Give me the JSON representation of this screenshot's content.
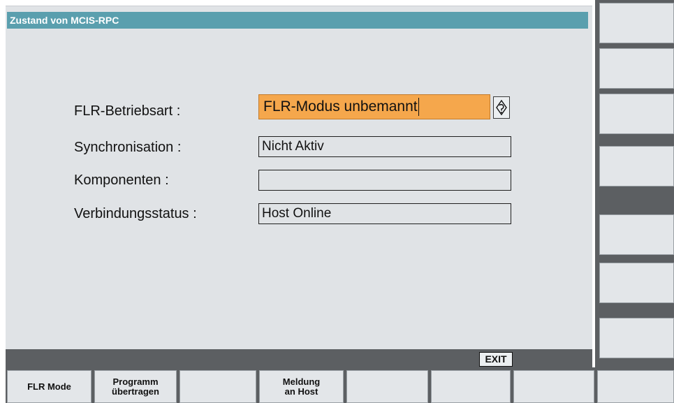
{
  "window": {
    "title": "Zustand von MCIS-RPC"
  },
  "form": {
    "mode_label": "FLR-Betriebsart :",
    "mode_value": "FLR-Modus unbemannt",
    "sync_label": "Synchronisation :",
    "sync_value": "Nicht Aktiv",
    "components_label": "Komponenten :",
    "components_value": "",
    "connection_label": "Verbindungsstatus :",
    "connection_value": "Host Online"
  },
  "status": {
    "exit_label": "EXIT"
  },
  "softkeys": {
    "horizontal": [
      "FLR Mode",
      "Programm\nübertragen",
      "",
      "Meldung\nan Host",
      "",
      "",
      "",
      ""
    ],
    "vertical": [
      "",
      "",
      "",
      "",
      "",
      "",
      "",
      ""
    ]
  },
  "icons": {
    "toggle": "toggle-icon"
  },
  "colors": {
    "title_bar": "#5a9fae",
    "panel_bg": "#e0e3e6",
    "active_field": "#f5a74c",
    "softkey_bg": "#e3e6e9",
    "frame_dark": "#5c5f62"
  }
}
